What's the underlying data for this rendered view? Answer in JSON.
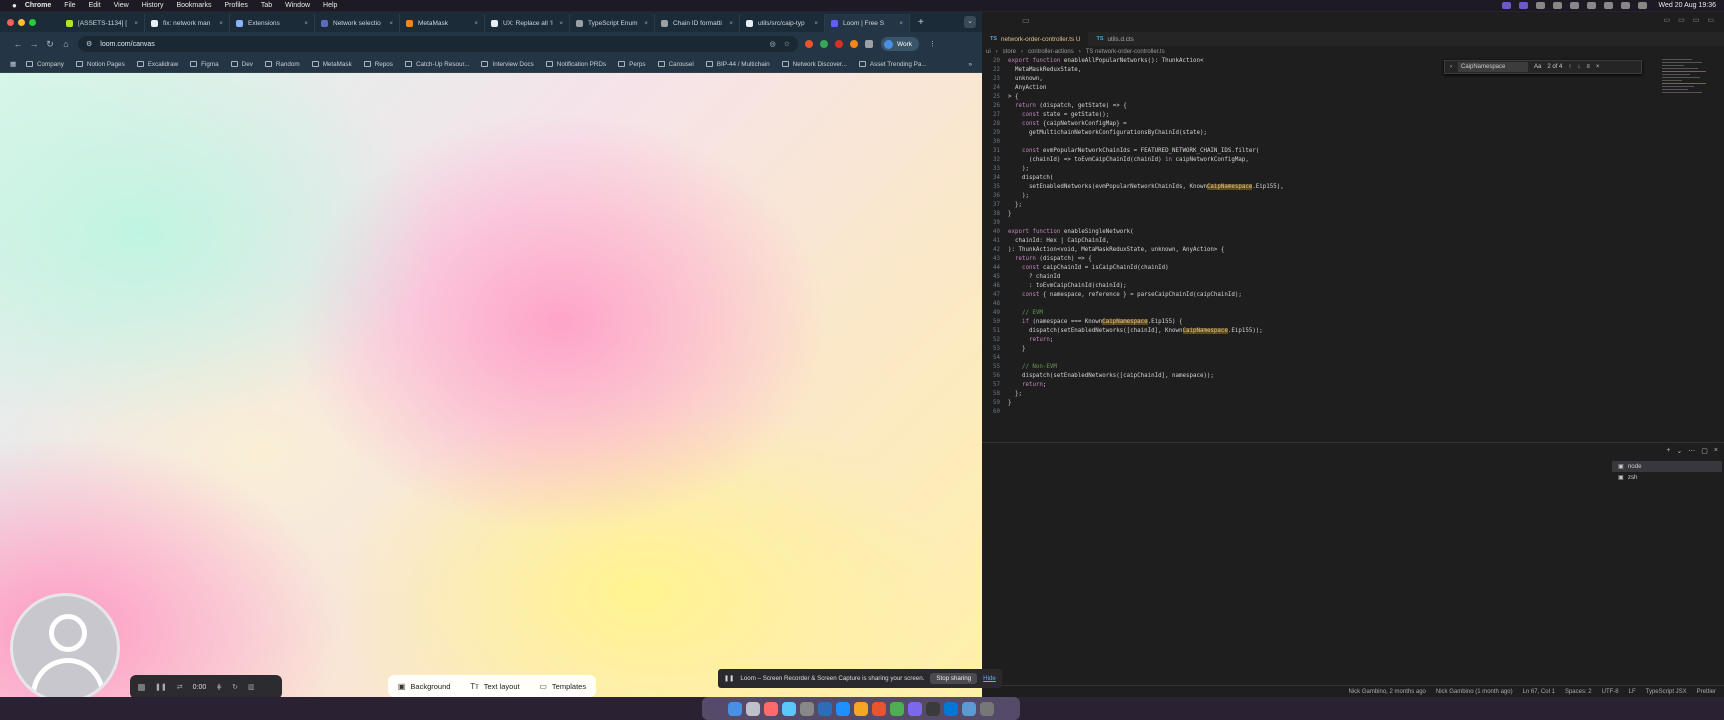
{
  "menubar": {
    "apple": "",
    "items": [
      "Chrome",
      "File",
      "Edit",
      "View",
      "History",
      "Bookmarks",
      "Profiles",
      "Tab",
      "Window",
      "Help"
    ],
    "clock": "Wed 20 Aug 19:36"
  },
  "chrome": {
    "tabs": [
      {
        "label": "[ASSETS-1134] [",
        "color": "#b5e61d"
      },
      {
        "label": "fix: network man",
        "color": "#e6edf3"
      },
      {
        "label": "Extensions",
        "color": "#8ab4f8"
      },
      {
        "label": "Network selectio",
        "color": "#5c6bc0"
      },
      {
        "label": "MetaMask",
        "color": "#f6851b"
      },
      {
        "label": "UX: Replace all ‘I",
        "color": "#e6edf3"
      },
      {
        "label": "TypeScript Enum",
        "color": "#9aa0a6"
      },
      {
        "label": "Chain ID formatti",
        "color": "#9aa0a6"
      },
      {
        "label": "utils/src/caip-typ",
        "color": "#e6edf3"
      },
      {
        "label": "Loom | Free S",
        "color": "#625df5"
      }
    ],
    "url": "loom.com/canvas",
    "profile": "Work",
    "bookmarks": [
      "Company",
      "Notion Pages",
      "Excalidraw",
      "Figma",
      "Dev",
      "Random",
      "MetaMask",
      "Repos",
      "Catch-Up Resour...",
      "Interview Docs",
      "Notification PRDs",
      "Perps",
      "Carousel",
      "BIP-44 / Multichain",
      "Network Discover...",
      "Asset Trending Pa..."
    ],
    "bookmarks_more": "»"
  },
  "loom": {
    "timer": "0:00",
    "tools": [
      "Background",
      "Text layout",
      "Templates"
    ],
    "share_message": "Loom – Screen Recorder & Screen Capture is sharing your screen.",
    "stop_label": "Stop sharing",
    "hide_label": "Hide"
  },
  "vscode": {
    "tabs": [
      {
        "lang": "TS",
        "label": "network-order-controller.ts U"
      },
      {
        "lang": "TS",
        "label": "utils.d.cts"
      }
    ],
    "breadcrumb": [
      "ui",
      "store",
      "controller-actions",
      "TS network-order-controller.ts"
    ],
    "find": {
      "query": "CaipNamespace",
      "count": "2 of 4",
      "case": "Aa"
    },
    "code": [
      {
        "n": "20",
        "t": "export function enableAllPopularNetworks(): ThunkAction<"
      },
      {
        "n": "22",
        "t": "  MetaMaskReduxState,"
      },
      {
        "n": "23",
        "t": "  unknown,"
      },
      {
        "n": "24",
        "t": "  AnyAction"
      },
      {
        "n": "25",
        "t": "> {"
      },
      {
        "n": "26",
        "t": "  return (dispatch, getState) => {"
      },
      {
        "n": "27",
        "t": "    const state = getState();"
      },
      {
        "n": "28",
        "t": "    const {caipNetworkConfigMap} ="
      },
      {
        "n": "29",
        "t": "      getMultichainNetworkConfigurationsByChainId(state);"
      },
      {
        "n": "30",
        "t": ""
      },
      {
        "n": "31",
        "t": "    const evmPopularNetworkChainIds = FEATURED_NETWORK_CHAIN_IDS.filter("
      },
      {
        "n": "32",
        "t": "      (chainId) => toEvmCaipChainId(chainId) in caipNetworkConfigMap,"
      },
      {
        "n": "33",
        "t": "    );"
      },
      {
        "n": "34",
        "t": "    dispatch("
      },
      {
        "n": "35",
        "t": "      setEnabledNetworks(evmPopularNetworkChainIds, KnownCaipNamespace.Eip155),"
      },
      {
        "n": "36",
        "t": "    );"
      },
      {
        "n": "37",
        "t": "  };"
      },
      {
        "n": "38",
        "t": "}"
      },
      {
        "n": "39",
        "t": ""
      },
      {
        "n": "40",
        "t": "export function enableSingleNetwork("
      },
      {
        "n": "41",
        "t": "  chainId: Hex | CaipChainId,"
      },
      {
        "n": "42",
        "t": "): ThunkAction<void, MetaMaskReduxState, unknown, AnyAction> {"
      },
      {
        "n": "43",
        "t": "  return (dispatch) => {"
      },
      {
        "n": "44",
        "t": "    const caipChainId = isCaipChainId(chainId)"
      },
      {
        "n": "45",
        "t": "      ? chainId"
      },
      {
        "n": "46",
        "t": "      : toEvmCaipChainId(chainId);"
      },
      {
        "n": "47",
        "t": "    const { namespace, reference } = parseCaipChainId(caipChainId);"
      },
      {
        "n": "48",
        "t": ""
      },
      {
        "n": "49",
        "t": "    // EVM"
      },
      {
        "n": "50",
        "t": "    if (namespace === KnownCaipNamespace.Eip155) {"
      },
      {
        "n": "51",
        "t": "      dispatch(setEnabledNetworks([chainId], KnownCaipNamespace.Eip155));"
      },
      {
        "n": "52",
        "t": "      return;"
      },
      {
        "n": "53",
        "t": "    }"
      },
      {
        "n": "54",
        "t": ""
      },
      {
        "n": "55",
        "t": "    // Non-EVM"
      },
      {
        "n": "56",
        "t": "    dispatch(setEnabledNetworks([caipChainId], namespace));"
      },
      {
        "n": "57",
        "t": "    return;"
      },
      {
        "n": "58",
        "t": "  };"
      },
      {
        "n": "59",
        "t": "}"
      },
      {
        "n": "60",
        "t": ""
      }
    ],
    "terminals": [
      "node",
      "zsh"
    ],
    "status": [
      "Nick Gambino, 2 months ago",
      "Nick Gambino (1 month ago)",
      "Ln 67, Col 1",
      "Spaces: 2",
      "UTF-8",
      "LF",
      "TypeScript JSX",
      "Prettier"
    ]
  },
  "dock": {
    "apps": [
      "#4a90e2",
      "#c0c0c8",
      "#ff6b6b",
      "#5ac8fa",
      "#888",
      "#2a6ebb",
      "#1e90ff",
      "#f5a623",
      "#e8542b",
      "#4caf50",
      "#7b68ee",
      "#3a3a3a",
      "#0078d4",
      "#5b9bd5",
      "#777"
    ]
  }
}
